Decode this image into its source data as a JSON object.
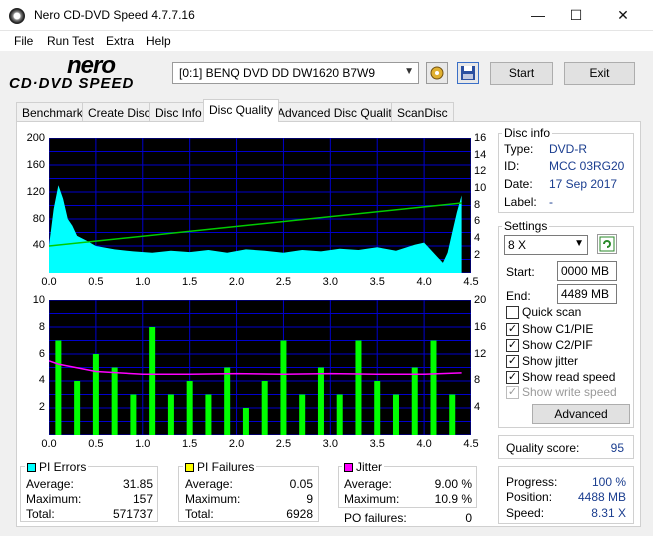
{
  "window": {
    "title": "Nero CD-DVD Speed 4.7.7.16",
    "minimize": "—",
    "maximize": "☐",
    "close": "✕"
  },
  "menu": [
    "File",
    "Run Test",
    "Extra",
    "Help"
  ],
  "logo": {
    "top": "nero",
    "bottom": "CD·DVD SPEED"
  },
  "toolbar": {
    "drive": "[0:1]   BENQ DVD DD DW1620 B7W9",
    "start_label": "Start",
    "exit_label": "Exit"
  },
  "tabs": [
    "Benchmark",
    "Create Disc",
    "Disc Info",
    "Disc Quality",
    "Advanced Disc Quality",
    "ScanDisc"
  ],
  "active_tab": "Disc Quality",
  "disc_info": {
    "title": "Disc info",
    "type_label": "Type:",
    "type": "DVD-R",
    "id_label": "ID:",
    "id": "MCC 03RG20",
    "date_label": "Date:",
    "date": "17 Sep 2017",
    "label_label": "Label:",
    "label": "-"
  },
  "settings": {
    "title": "Settings",
    "speed": "8 X",
    "start_label": "Start:",
    "start": "0000 MB",
    "end_label": "End:",
    "end": "4489 MB",
    "quick_scan": "Quick scan",
    "show_c1": "Show C1/PIE",
    "show_c2": "Show C2/PIF",
    "show_jitter": "Show jitter",
    "show_read": "Show read speed",
    "show_write": "Show write speed",
    "advanced_label": "Advanced"
  },
  "quality": {
    "label": "Quality score:",
    "value": "95"
  },
  "progress": {
    "progress_label": "Progress:",
    "progress": "100 %",
    "position_label": "Position:",
    "position": "4488 MB",
    "speed_label": "Speed:",
    "speed": "8.31 X"
  },
  "pi_errors": {
    "title": "PI Errors",
    "avg_label": "Average:",
    "avg": "31.85",
    "max_label": "Maximum:",
    "max": "157",
    "total_label": "Total:",
    "total": "571737"
  },
  "pi_failures": {
    "title": "PI Failures",
    "avg_label": "Average:",
    "avg": "0.05",
    "max_label": "Maximum:",
    "max": "9",
    "total_label": "Total:",
    "total": "6928"
  },
  "jitter": {
    "title": "Jitter",
    "avg_label": "Average:",
    "avg": "9.00 %",
    "max_label": "Maximum:",
    "max": "10.9 %",
    "po_label": "PO failures:",
    "po": "0"
  },
  "colors": {
    "pie": "#00ffff",
    "pif": "#00ff00",
    "jitter": "#ff00ff",
    "speed": "#00cc00",
    "chart_bg": "#000000",
    "grid": "#0000cc"
  },
  "chart_data": [
    {
      "type": "area",
      "name": "PI errors",
      "x_ticks": [
        "0.0",
        "0.5",
        "1.0",
        "1.5",
        "2.0",
        "2.5",
        "3.0",
        "3.5",
        "4.0",
        "4.5"
      ],
      "y_left_ticks": [
        "200",
        "160",
        "120",
        "80",
        "40"
      ],
      "y_right_ticks": [
        "16",
        "14",
        "12",
        "10",
        "8",
        "6",
        "4",
        "2"
      ],
      "xlim": [
        0,
        4.5
      ],
      "ylim": [
        0,
        200
      ],
      "y2lim": [
        0,
        16
      ],
      "series": [
        {
          "x": [
            0.0,
            0.05,
            0.1,
            0.15,
            0.2,
            0.25,
            0.3,
            0.4,
            0.5,
            0.7,
            0.9,
            1.1,
            1.3,
            1.5,
            1.7,
            1.9,
            2.1,
            2.3,
            2.5,
            2.7,
            2.9,
            3.1,
            3.3,
            3.5,
            3.7,
            3.9,
            4.0,
            4.1,
            4.2,
            4.25,
            4.3,
            4.35,
            4.4
          ],
          "values": [
            40,
            95,
            130,
            110,
            80,
            70,
            55,
            48,
            40,
            35,
            32,
            30,
            33,
            31,
            34,
            30,
            35,
            33,
            30,
            34,
            32,
            36,
            34,
            38,
            33,
            42,
            45,
            30,
            15,
            30,
            60,
            90,
            115
          ]
        }
      ],
      "speed": {
        "x": [
          0.0,
          4.4
        ],
        "values": [
          3.2,
          8.3
        ]
      }
    },
    {
      "type": "bar",
      "name": "PI failures",
      "x_ticks": [
        "0.0",
        "0.5",
        "1.0",
        "1.5",
        "2.0",
        "2.5",
        "3.0",
        "3.5",
        "4.0",
        "4.5"
      ],
      "y_left_ticks": [
        "10",
        "8",
        "6",
        "4",
        "2"
      ],
      "y_right_ticks": [
        "20",
        "16",
        "12",
        "8",
        "4"
      ],
      "xlim": [
        0,
        4.5
      ],
      "ylim": [
        0,
        10
      ],
      "y2lim": [
        0,
        20
      ],
      "series": [
        {
          "x": [
            0.1,
            0.3,
            0.5,
            0.7,
            0.9,
            1.1,
            1.3,
            1.5,
            1.7,
            1.9,
            2.1,
            2.3,
            2.5,
            2.7,
            2.9,
            3.1,
            3.3,
            3.5,
            3.7,
            3.9,
            4.1,
            4.3
          ],
          "values": [
            7,
            4,
            6,
            5,
            3,
            8,
            3,
            4,
            3,
            5,
            2,
            4,
            7,
            3,
            5,
            3,
            7,
            4,
            3,
            5,
            7,
            3
          ]
        }
      ],
      "jitter": {
        "x": [
          0.0,
          0.1,
          0.5,
          1.0,
          1.5,
          2.0,
          2.5,
          3.0,
          3.5,
          4.0,
          4.4
        ],
        "values": [
          11,
          10.5,
          9.4,
          9.0,
          9.0,
          9.1,
          9.0,
          9.1,
          9.0,
          9.0,
          9.2
        ]
      }
    }
  ]
}
